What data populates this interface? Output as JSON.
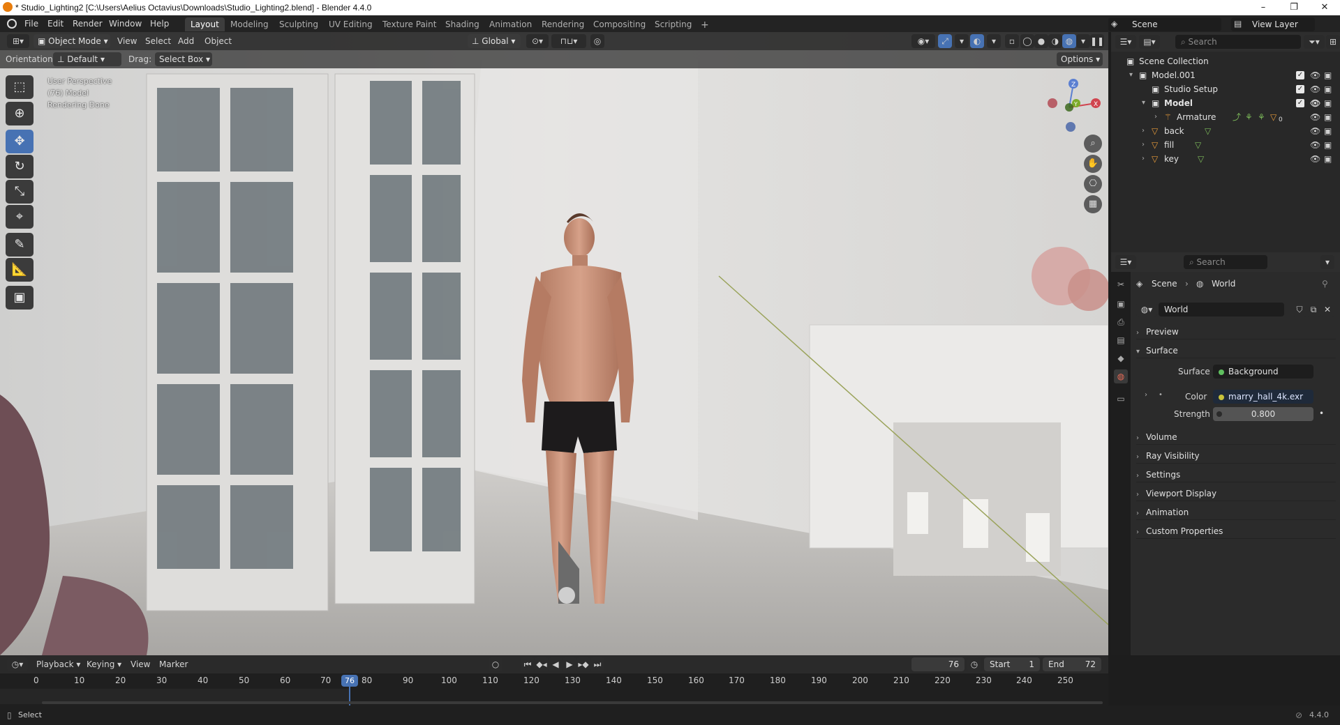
{
  "titlebar": {
    "title": "* Studio_Lighting2 [C:\\Users\\Aelius Octavius\\Downloads\\Studio_Lighting2.blend] - Blender 4.4.0",
    "minimize": "–",
    "maximize": "❐",
    "close": "✕"
  },
  "menubar": {
    "items": [
      "File",
      "Edit",
      "Render",
      "Window",
      "Help"
    ],
    "workspaces": [
      "Layout",
      "Modeling",
      "Sculpting",
      "UV Editing",
      "Texture Paint",
      "Shading",
      "Animation",
      "Rendering",
      "Compositing",
      "Scripting"
    ],
    "add_workspace": "+",
    "scene": "Scene",
    "view_layer": "View Layer"
  },
  "viewport_header": {
    "mode": "Object Mode",
    "menus": [
      "View",
      "Select",
      "Add",
      "Object"
    ],
    "transform_orientation": "Global",
    "orientation_label": "Orientation:",
    "orientation_value": "Default",
    "drag_label": "Drag:",
    "drag_value": "Select Box",
    "options": "Options"
  },
  "viewport_overlay": {
    "line1": "User Perspective",
    "line2": "(76) Model",
    "line3": "Rendering Done"
  },
  "gizmo": {
    "z": "Z",
    "y": "Y",
    "x": "X"
  },
  "outliner": {
    "search_placeholder": "Search",
    "root": "Scene Collection",
    "rows": [
      {
        "name": "Model.001"
      },
      {
        "name": "Studio Setup"
      },
      {
        "name": "Model"
      },
      {
        "name": "Armature",
        "badge": "0"
      },
      {
        "name": "back"
      },
      {
        "name": "fill"
      },
      {
        "name": "key"
      }
    ]
  },
  "properties": {
    "search_placeholder": "Search",
    "breadcrumb_scene": "Scene",
    "breadcrumb_world": "World",
    "world_name": "World",
    "sections": [
      "Preview",
      "Surface",
      "Volume",
      "Ray Visibility",
      "Settings",
      "Viewport Display",
      "Animation",
      "Custom Properties"
    ],
    "surface_label": "Surface",
    "surface_value": "Background",
    "color_label": "Color",
    "color_value": "marry_hall_4k.exr",
    "strength_label": "Strength",
    "strength_value": "0.800"
  },
  "timeline": {
    "menus": [
      "Playback",
      "Keying",
      "View",
      "Marker"
    ],
    "current_frame": "76",
    "start_label": "Start",
    "start": "1",
    "end_label": "End",
    "end": "72",
    "ticks": [
      "0",
      "10",
      "20",
      "30",
      "40",
      "50",
      "60",
      "70",
      "80",
      "90",
      "100",
      "110",
      "120",
      "130",
      "140",
      "150",
      "160",
      "170",
      "180",
      "190",
      "200",
      "210",
      "220",
      "230",
      "240",
      "250"
    ],
    "playhead": "76"
  },
  "statusbar": {
    "left": "Select",
    "version": "4.4.0"
  },
  "colors": {
    "accent": "#4772b3",
    "playhead": "#4772b3"
  }
}
